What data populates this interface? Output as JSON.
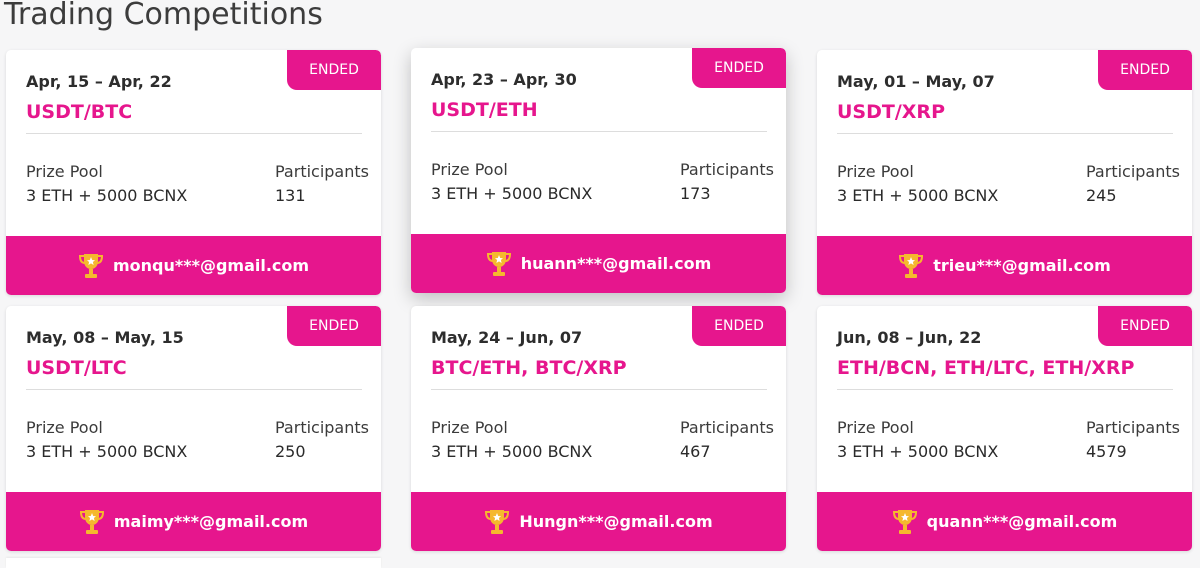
{
  "page": {
    "title": "Trading Competitions"
  },
  "colors": {
    "accent": "#e6168d",
    "background": "#f6f6f7",
    "trophy": "#f5b82e"
  },
  "competitions": [
    {
      "status": "ENDED",
      "dates": "Apr, 15 – Apr, 22",
      "pair": "USDT/BTC",
      "prize_label": "Prize Pool",
      "prize_value": "3 ETH + 5000 BCNX",
      "participants_label": "Participants",
      "participants_value": "131",
      "winner_icon": "trophy-icon",
      "winner": "monqu***@gmail.com"
    },
    {
      "status": "ENDED",
      "dates": "Apr, 23 – Apr, 30",
      "pair": "USDT/ETH",
      "prize_label": "Prize Pool",
      "prize_value": "3 ETH + 5000 BCNX",
      "participants_label": "Participants",
      "participants_value": "173",
      "winner_icon": "trophy-icon",
      "winner": "huann***@gmail.com"
    },
    {
      "status": "ENDED",
      "dates": "May, 01 – May, 07",
      "pair": "USDT/XRP",
      "prize_label": "Prize Pool",
      "prize_value": "3 ETH + 5000 BCNX",
      "participants_label": "Participants",
      "participants_value": "245",
      "winner_icon": "trophy-icon",
      "winner": "trieu***@gmail.com"
    },
    {
      "status": "ENDED",
      "dates": "May, 08 – May, 15",
      "pair": "USDT/LTC",
      "prize_label": "Prize Pool",
      "prize_value": "3 ETH + 5000 BCNX",
      "participants_label": "Participants",
      "participants_value": "250",
      "winner_icon": "trophy-icon",
      "winner": "maimy***@gmail.com"
    },
    {
      "status": "ENDED",
      "dates": "May, 24 – Jun, 07",
      "pair": "BTC/ETH, BTC/XRP",
      "prize_label": "Prize Pool",
      "prize_value": "3 ETH + 5000 BCNX",
      "participants_label": "Participants",
      "participants_value": "467",
      "winner_icon": "trophy-icon",
      "winner": "Hungn***@gmail.com"
    },
    {
      "status": "ENDED",
      "dates": "Jun, 08 – Jun, 22",
      "pair": "ETH/BCN, ETH/LTC, ETH/XRP",
      "prize_label": "Prize Pool",
      "prize_value": "3 ETH + 5000 BCNX",
      "participants_label": "Participants",
      "participants_value": "4579",
      "winner_icon": "trophy-icon",
      "winner": "quann***@gmail.com"
    }
  ]
}
